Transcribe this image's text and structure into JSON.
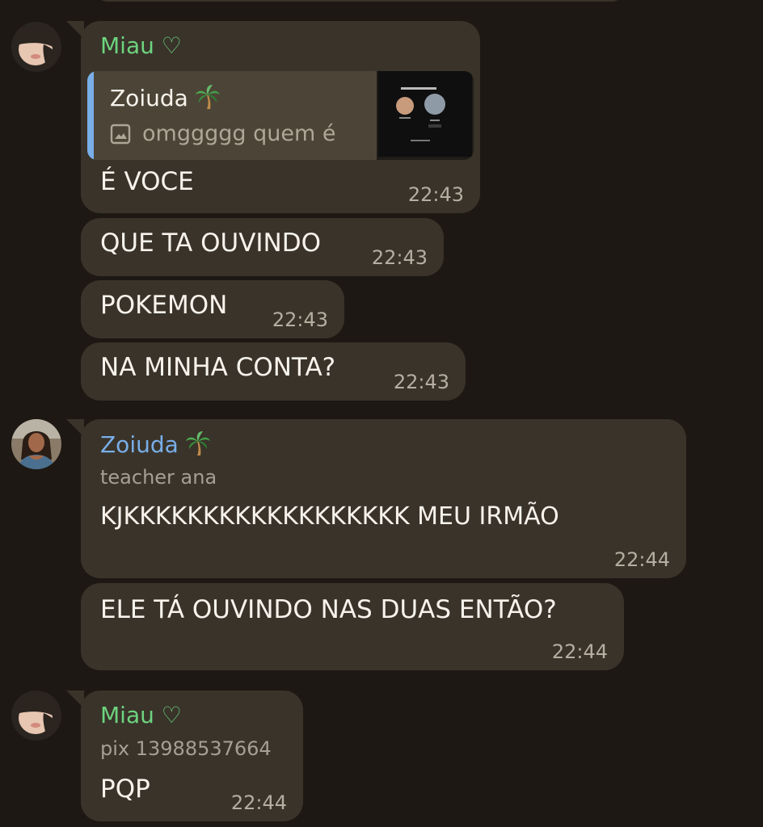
{
  "users": {
    "miau": {
      "name": "Miau ♡",
      "color": "#6dd37e"
    },
    "zoiuda": {
      "name": "Zoiuda",
      "color": "#79aee8",
      "status": "teacher ana"
    },
    "miau_status": "pix 13988537664"
  },
  "messages": [
    {
      "reply": {
        "name": "Zoiuda",
        "text": "omggggg quem é"
      },
      "text": "É VOCE",
      "time": "22:43"
    },
    {
      "text": "QUE TA OUVINDO",
      "time": "22:43"
    },
    {
      "text": "POKEMON",
      "time": "22:43"
    },
    {
      "text": "NA MINHA CONTA?",
      "time": "22:43"
    },
    {
      "text": "KJKKKKKKKKKKKKKKKKKK MEU IRMÃO",
      "time": "22:44"
    },
    {
      "text": "ELE TÁ OUVINDO NAS DUAS ENTÃO?",
      "time": "22:44"
    },
    {
      "text": "PQP",
      "time": "22:44"
    }
  ],
  "colors": {
    "background": "#1d1813",
    "bubble": "#39332a",
    "reply_box": "#4c4537",
    "accent_blue": "#79aee8",
    "accent_green": "#6dd37e"
  },
  "icons": {
    "reply_media": "image-icon",
    "sender_emoji": "palm-tree-icon",
    "avatar_a": "avatar-miau",
    "avatar_b": "avatar-zoiuda"
  }
}
